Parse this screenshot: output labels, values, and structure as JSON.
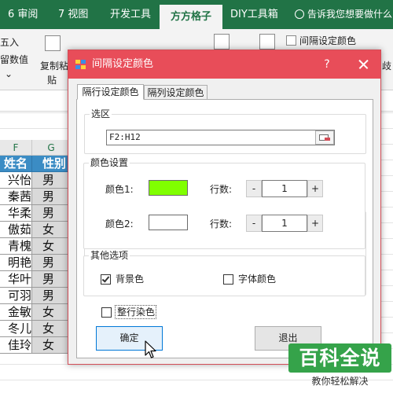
{
  "ribbon": {
    "tabs": [
      {
        "label": "6 审阅"
      },
      {
        "label": "7 视图"
      },
      {
        "label": "开发工具"
      },
      {
        "label": "方方格子"
      },
      {
        "label": "DIY工具箱"
      }
    ],
    "active_tab": "方方格子",
    "tell_me": "告诉我您想要做什么",
    "body": {
      "left_text_1": "五入",
      "left_text_2": "留数值",
      "copy_paste_1": "复制粘",
      "copy_paste_2": "贴",
      "interval_color": "间隔设定颜色",
      "right_partial": "歧"
    }
  },
  "sheet": {
    "columns": [
      "F",
      "G"
    ],
    "header": {
      "name": "姓名",
      "sex": "性别"
    },
    "rows": [
      {
        "name": "兴怡",
        "sex": "男"
      },
      {
        "name": "秦茜",
        "sex": "男"
      },
      {
        "name": "华柔",
        "sex": "男"
      },
      {
        "name": "傲茹",
        "sex": "女"
      },
      {
        "name": "青槐",
        "sex": "女"
      },
      {
        "name": "明艳",
        "sex": "男"
      },
      {
        "name": "华叶",
        "sex": "男"
      },
      {
        "name": "可羽",
        "sex": "男"
      },
      {
        "name": "金敏",
        "sex": "女"
      },
      {
        "name": "冬儿",
        "sex": "女"
      },
      {
        "name": "佳玲",
        "sex": "女"
      }
    ]
  },
  "dialog": {
    "title": "间隔设定颜色",
    "help": "?",
    "tabs": [
      {
        "label": "隔行设定颜色",
        "active": true
      },
      {
        "label": "隔列设定颜色",
        "active": false
      }
    ],
    "selection": {
      "group_title": "选区",
      "range_value": "F2:H12"
    },
    "color_settings": {
      "group_title": "颜色设置",
      "color1_label": "颜色1:",
      "color1_value": "#80ff00",
      "color2_label": "颜色2:",
      "color2_value": "#ffffff",
      "rows1_label": "行数:",
      "rows1_value": "1",
      "rows2_label": "行数:",
      "rows2_value": "1",
      "minus": "-",
      "plus": "+"
    },
    "other_options": {
      "group_title": "其他选项",
      "background_label": "背景色",
      "background_checked": true,
      "font_color_label": "字体颜色",
      "font_color_checked": false
    },
    "whole_row_label": "整行染色",
    "whole_row_checked": false,
    "ok_label": "确定",
    "exit_label": "退出"
  },
  "watermark": {
    "title": "百科全说",
    "subtitle": "教你轻松解决"
  },
  "colors": {
    "excel_green": "#217346",
    "dialog_titlebar": "#e84d59",
    "header_blue": "#3b8cc4",
    "row_gray": "#d9d9d9",
    "watermark_green": "#35a34a"
  }
}
